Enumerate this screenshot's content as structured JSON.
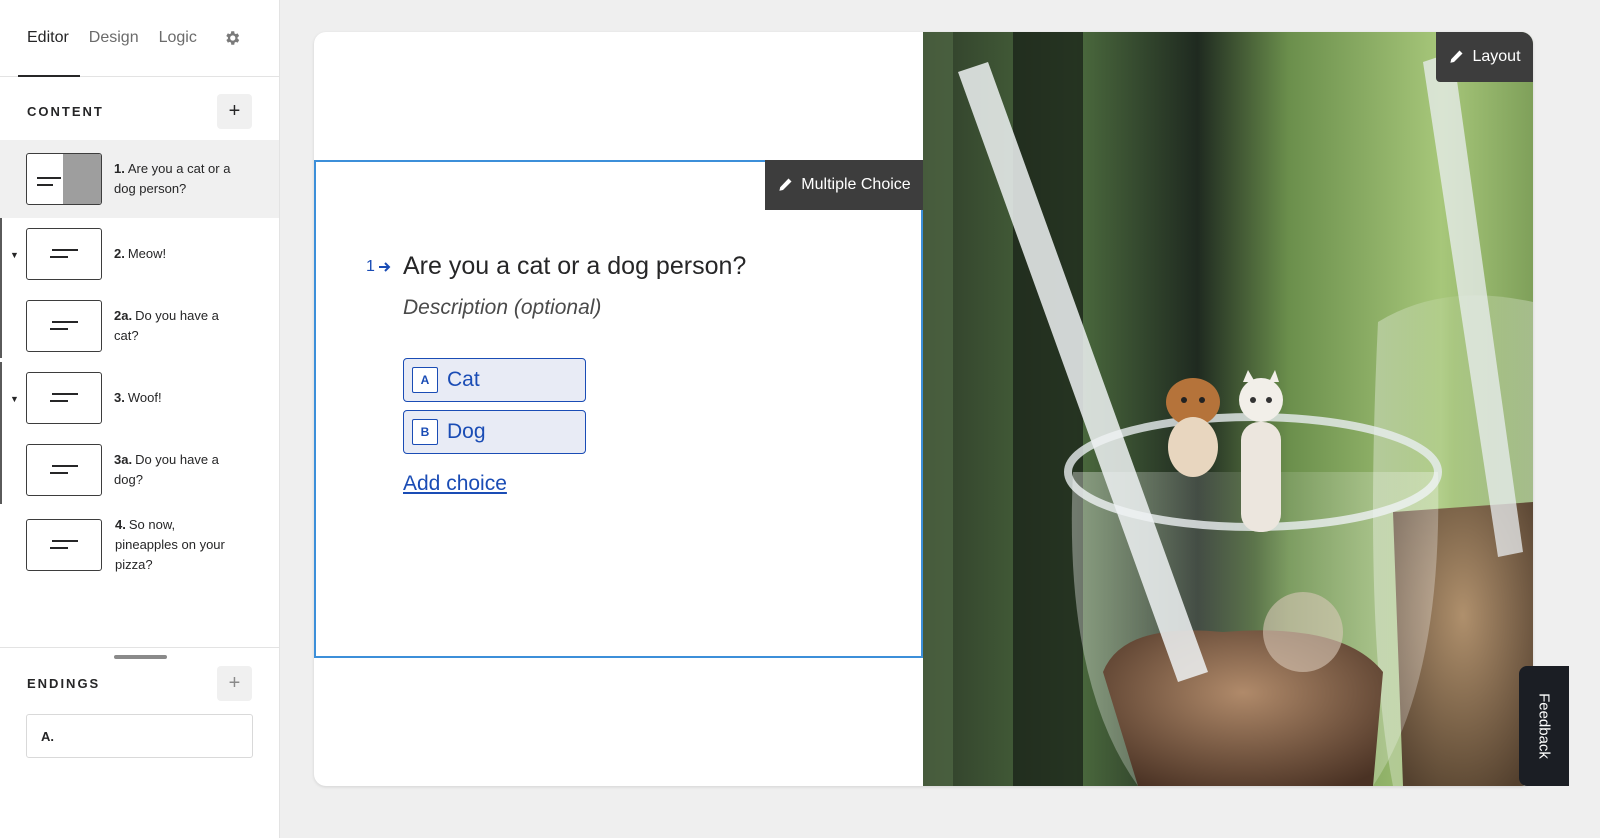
{
  "tabs": [
    "Editor",
    "Design",
    "Logic"
  ],
  "content_section": {
    "title": "CONTENT",
    "add": "+"
  },
  "questions": [
    {
      "num": "1.",
      "text": "Are you a cat or a dog person?"
    },
    {
      "num": "2.",
      "text": "Meow!"
    },
    {
      "num": "2a.",
      "text": "Do you have a cat?"
    },
    {
      "num": "3.",
      "text": "Woof!"
    },
    {
      "num": "3a.",
      "text": "Do you have a dog?"
    },
    {
      "num": "4.",
      "text": "So now, pineapples on your pizza?"
    }
  ],
  "endings_section": {
    "title": "ENDINGS",
    "add": "+",
    "first": "A."
  },
  "canvas": {
    "layout_label": "Layout",
    "type_label": "Multiple Choice",
    "question_number": "1",
    "question_title": "Are you a cat or a dog person?",
    "description": "Description (optional)",
    "choices": [
      {
        "key": "A",
        "label": "Cat"
      },
      {
        "key": "B",
        "label": "Dog"
      }
    ],
    "add_choice": "Add choice"
  },
  "feedback": "Feedback",
  "colors": {
    "accent": "#1a4cb5",
    "selection_border": "#3c8fd9",
    "dark_tag": "#3d3d3d"
  }
}
